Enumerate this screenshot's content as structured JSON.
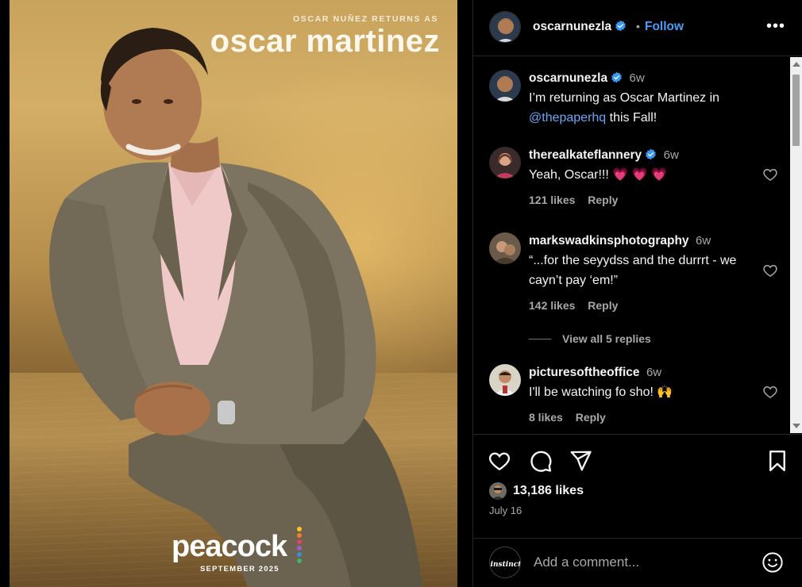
{
  "promo": {
    "kicker": "OSCAR NUÑEZ RETURNS AS",
    "title": "oscar martinez",
    "logo": "peacock",
    "date": "SEPTEMBER 2025"
  },
  "header": {
    "username": "oscarnunezla",
    "separator": "•",
    "follow_label": "Follow",
    "more_label": "•••"
  },
  "caption": {
    "username": "oscarnunezla",
    "time": "6w",
    "text_before": "I’m returning as Oscar Martinez in",
    "mention": "@thepaperhq",
    "text_after": " this Fall!"
  },
  "comments": [
    {
      "username": "therealkateflannery",
      "verified": true,
      "time": "6w",
      "text": "Yeah, Oscar!!! 💗 💗 💗",
      "likes": "121 likes",
      "reply": "Reply"
    },
    {
      "username": "markswadkinsphotography",
      "verified": false,
      "time": "6w",
      "text": "“...for the seyydss and the durrrt - we cayn’t pay ‘em!”",
      "likes": "142 likes",
      "reply": "Reply",
      "view_replies": "View all 5 replies"
    },
    {
      "username": "picturesoftheoffice",
      "verified": false,
      "time": "6w",
      "text": "I'll be watching fo sho! 🙌",
      "likes": "8 likes",
      "reply": "Reply"
    }
  ],
  "actions": {
    "icons": [
      "heart-icon",
      "comment-icon",
      "share-icon",
      "bookmark-icon"
    ],
    "likes": "13,186 likes",
    "date": "July 16"
  },
  "add_comment": {
    "avatar_text": "instinct",
    "placeholder": "Add a comment..."
  },
  "colors": {
    "accent": "#4a9cf7",
    "mention": "#6aa7f5",
    "secondary_text": "#a8a8a8",
    "border": "#262626"
  }
}
